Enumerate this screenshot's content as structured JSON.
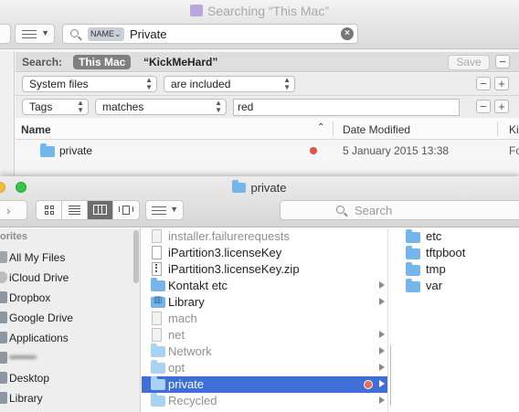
{
  "search_window": {
    "title": "Searching “This Mac”",
    "search_token": "NAME⌄",
    "search_value": "Private",
    "scope_label": "Search:",
    "scope_active": "This Mac",
    "scope_other": "“KickMeHard”",
    "save_label": "Save",
    "plus": "+",
    "minus": "−",
    "rule1": {
      "attribute": "System files",
      "operator": "are included"
    },
    "rule2": {
      "attribute": "Tags",
      "operator": "matches",
      "value": "red"
    },
    "columns": {
      "name": "Name",
      "date": "Date Modified",
      "kind": "Ki"
    },
    "result": {
      "name": "private",
      "date": "5 January 2015 13:38",
      "kind": "Fo",
      "tag_color": "#e0533d"
    }
  },
  "finder_window": {
    "title": "private",
    "search_placeholder": "Search",
    "sidebar": {
      "heading": "orites",
      "items": [
        {
          "label": "All My Files",
          "icon": "all-files-icon"
        },
        {
          "label": "iCloud Drive",
          "icon": "cloud-icon"
        },
        {
          "label": "Dropbox",
          "icon": "dropbox-icon"
        },
        {
          "label": "Google Drive",
          "icon": "google-drive-icon"
        },
        {
          "label": "Applications",
          "icon": "applications-icon"
        },
        {
          "label": "",
          "icon": "user-home-icon"
        },
        {
          "label": "Desktop",
          "icon": "desktop-icon"
        },
        {
          "label": "Library",
          "icon": "library-icon"
        }
      ]
    },
    "column1": [
      {
        "label": "installer.failurerequests"
      },
      {
        "label": "iPartition3.licenseKey"
      },
      {
        "label": "iPartition3.licenseKey.zip"
      },
      {
        "label": "Kontakt etc"
      },
      {
        "label": "Library"
      },
      {
        "label": "mach"
      },
      {
        "label": "net"
      },
      {
        "label": "Network"
      },
      {
        "label": "opt"
      },
      {
        "label": "private"
      },
      {
        "label": "Recycled"
      }
    ],
    "column2": [
      {
        "label": "etc"
      },
      {
        "label": "tftpboot"
      },
      {
        "label": "tmp"
      },
      {
        "label": "var"
      }
    ],
    "selection_color": "#3f6ed8",
    "selected_tag_color": "#e66d60"
  }
}
